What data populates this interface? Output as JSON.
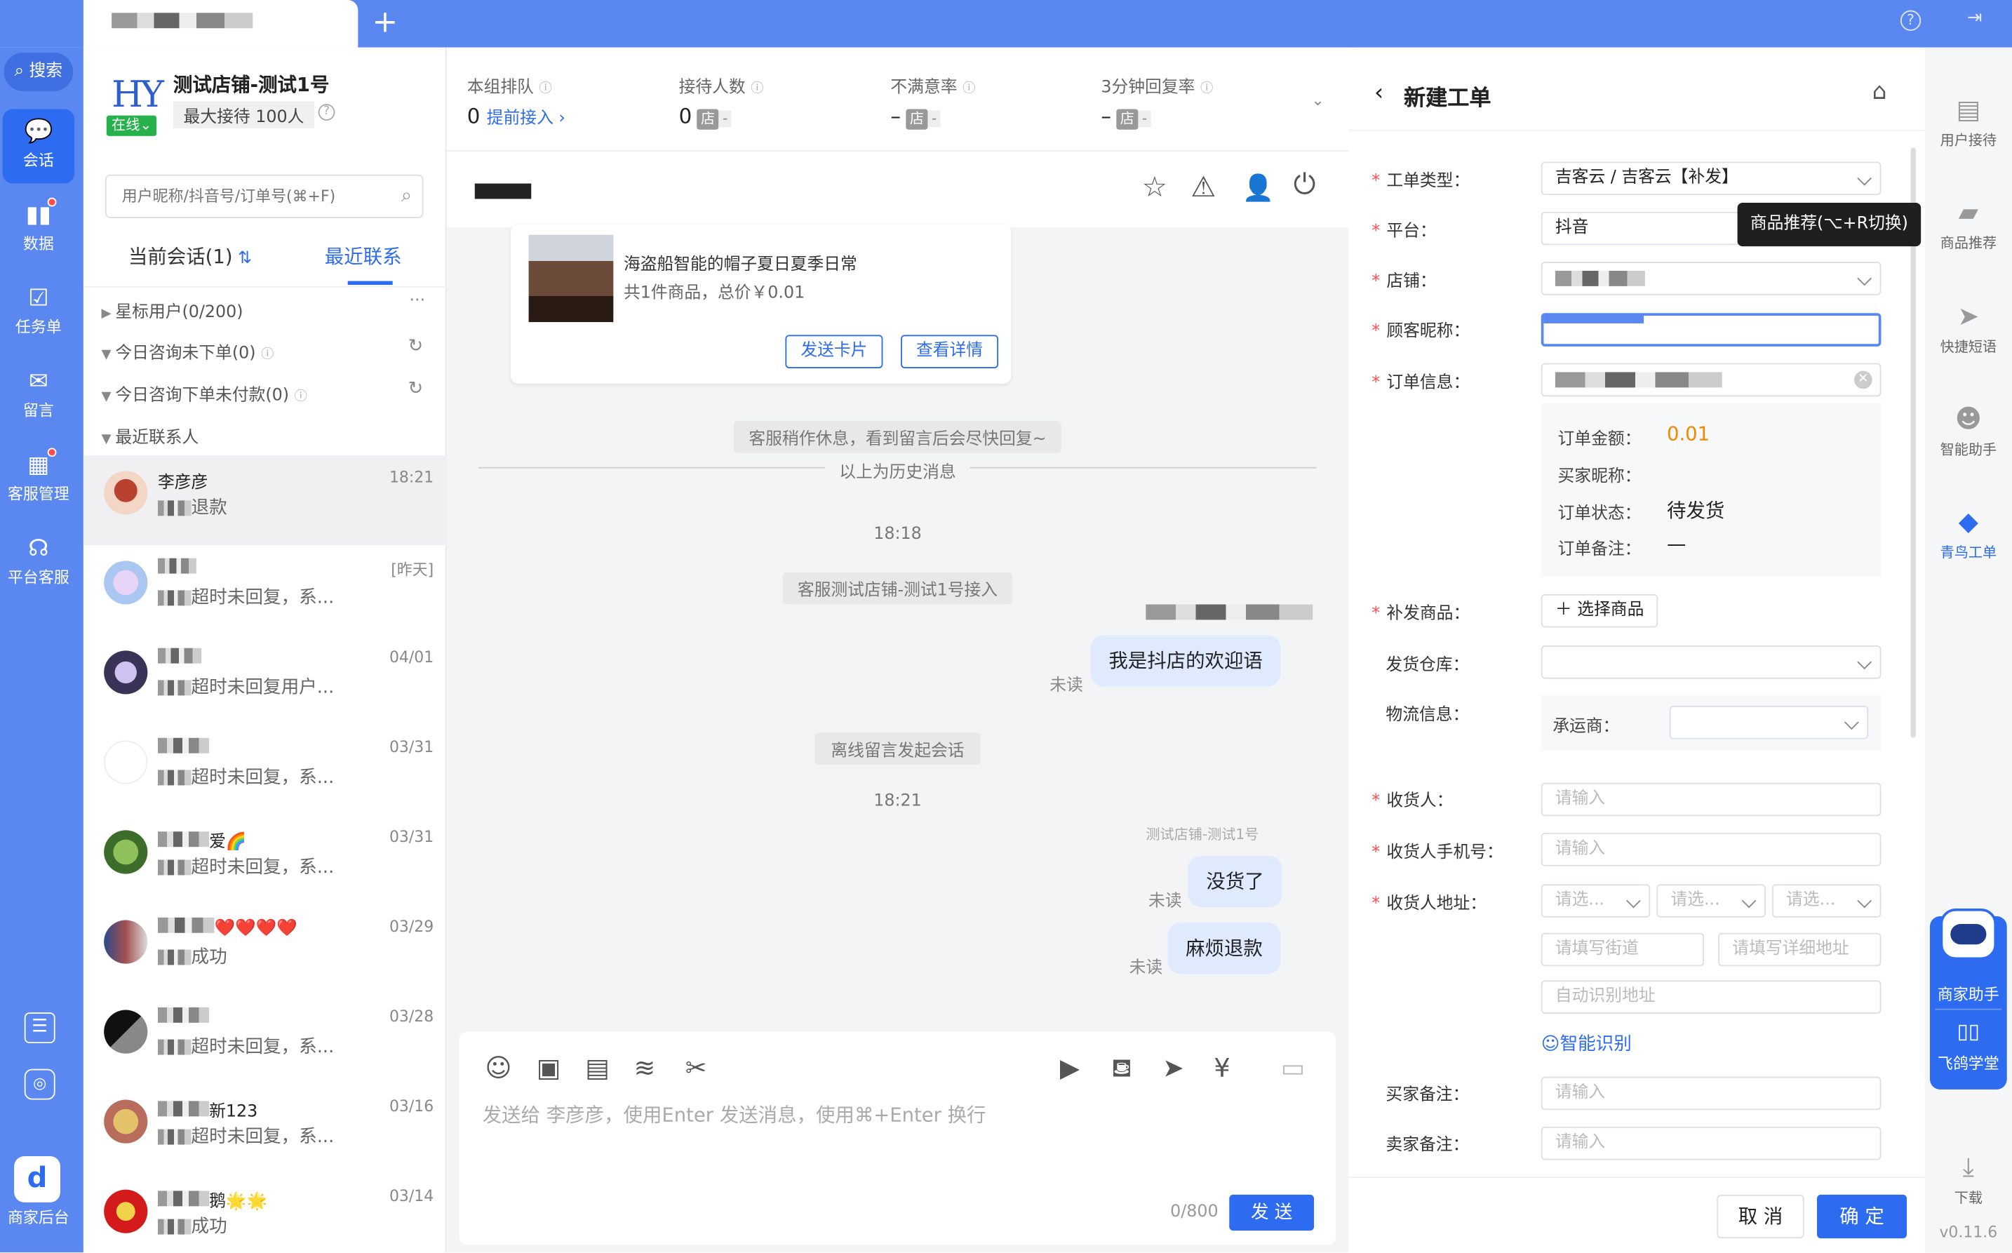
{
  "tabs": {
    "add_label": "+"
  },
  "top_icons": {
    "help": "?",
    "logout": "⇥"
  },
  "left_rail": {
    "search": "搜索",
    "items": [
      {
        "label": "会话",
        "icon": "chat-bubble-icon"
      },
      {
        "label": "数据",
        "icon": "bar-chart-icon"
      },
      {
        "label": "任务单",
        "icon": "calendar-check-icon"
      },
      {
        "label": "留言",
        "icon": "mail-icon"
      },
      {
        "label": "客服管理",
        "icon": "grid-icon"
      },
      {
        "label": "平台客服",
        "icon": "headset-icon"
      }
    ],
    "bottom": [
      {
        "icon": "checklist-icon"
      },
      {
        "icon": "hexagon-settings-icon"
      }
    ],
    "merchant_backend": "商家后台"
  },
  "shop": {
    "logo": "HY",
    "name": "测试店铺-测试1号",
    "status": "在线",
    "capacity": "最大接待 100人"
  },
  "search": {
    "placeholder": "用户昵称/抖音号/订单号(⌘+F)"
  },
  "conv_tabs": {
    "current": "当前会话(1)",
    "recent": "最近联系"
  },
  "groups": [
    {
      "label": "星标用户(0/200)"
    },
    {
      "label": "今日咨询未下单(0)"
    },
    {
      "label": "今日咨询下单未付款(0)"
    },
    {
      "label": "最近联系人"
    }
  ],
  "contacts": [
    {
      "name": "李彦彦",
      "msg": "退款",
      "time": "18:21"
    },
    {
      "name": "",
      "msg": "超时未回复，系...",
      "time": "[昨天]"
    },
    {
      "name": "",
      "msg": "超时未回复用户...",
      "time": "04/01"
    },
    {
      "name": "",
      "msg": "超时未回复，系...",
      "time": "03/31"
    },
    {
      "name": "爱🌈",
      "msg": "超时未回复，系...",
      "time": "03/31"
    },
    {
      "name": "❤️❤️❤️❤️",
      "msg": "成功",
      "time": "03/29"
    },
    {
      "name": "",
      "msg": "超时未回复，系...",
      "time": "03/28"
    },
    {
      "name": "新123",
      "msg": "超时未回复，系...",
      "time": "03/16"
    },
    {
      "name": "鹅🌟🌟",
      "msg": "成功",
      "time": "03/14"
    }
  ],
  "metrics": [
    {
      "label": "本组排队",
      "value": "0",
      "extra": "提前接入 ›"
    },
    {
      "label": "接待人数",
      "value": "0",
      "badge": "店",
      "dash": "-"
    },
    {
      "label": "不满意率",
      "value": "–",
      "badge": "店",
      "dash": "-"
    },
    {
      "label": "3分钟回复率",
      "value": "–",
      "badge": "店",
      "dash": "-"
    }
  ],
  "order_card": {
    "title": "海盗船智能的帽子夏日夏季日常",
    "summary": "共1件商品，总价￥0.01",
    "send_btn": "发送卡片",
    "detail_btn": "查看详情"
  },
  "messages": {
    "tip_rest": "客服稍作休息，看到留言后会尽快回复~",
    "history": "以上为历史消息",
    "time1": "18:18",
    "joined": "客服测试店铺-测试1号接入",
    "bubble1": "我是抖店的欢迎语",
    "unread": "未读",
    "offline": "离线留言发起会话",
    "time2": "18:21",
    "sender2": "测试店铺-测试1号",
    "bubble2": "没货了",
    "bubble3": "麻烦退款"
  },
  "composer": {
    "placeholder": "发送给 李彦彦，使用Enter 发送消息，使用⌘+Enter 换行",
    "counter": "0/800",
    "send": "发 送"
  },
  "ticket": {
    "title": "新建工单",
    "type_label": "工单类型：",
    "type_value": "吉客云 / 吉客云【补发】",
    "platform_label": "平台：",
    "platform_value": "抖音",
    "tooltip": "商品推荐(⌥+R切换)",
    "store_label": "店铺：",
    "nickname_label": "顾客昵称：",
    "order_label": "订单信息：",
    "amount_label": "订单金额：",
    "amount_value": "0.01",
    "buyer_label": "买家昵称：",
    "status_label": "订单状态：",
    "status_value": "待发货",
    "remark_label": "订单备注：",
    "remark_value": "—",
    "goods_label": "补发商品：",
    "goods_btn": "选择商品",
    "warehouse_label": "发货仓库：",
    "logistics_label": "物流信息：",
    "carrier_label": "承运商：",
    "receiver_label": "收货人：",
    "receiver_ph": "请输入",
    "phone_label": "收货人手机号：",
    "phone_ph": "请输入",
    "address_label": "收货人地址：",
    "select_ph": "请选...",
    "street_ph": "请填写街道",
    "detail_ph": "请填写详细地址",
    "auto_ph": "自动识别地址",
    "smart": "智能识别",
    "buyer_note_label": "买家备注：",
    "buyer_note_ph": "请输入",
    "seller_note_label": "卖家备注：",
    "seller_note_ph": "请输入",
    "cancel": "取 消",
    "confirm": "确 定"
  },
  "right_rail": {
    "items": [
      {
        "label": "用户接待",
        "icon": "doc-icon"
      },
      {
        "label": "商品推荐",
        "icon": "bag-icon"
      },
      {
        "label": "快捷短语",
        "icon": "paper-plane-icon"
      },
      {
        "label": "智能助手",
        "icon": "robot-face-icon"
      },
      {
        "label": "青鸟工单",
        "icon": "cube-icon"
      }
    ],
    "assistant": "商家助手",
    "academy": "飞鸽学堂",
    "download": "下载",
    "version": "v0.11.6"
  }
}
